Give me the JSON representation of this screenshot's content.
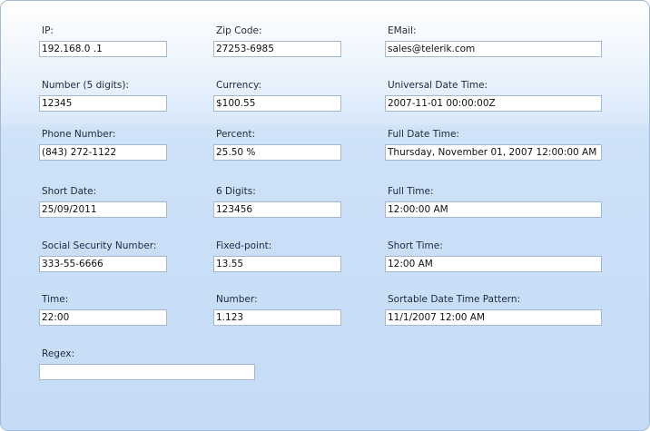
{
  "fields": {
    "ip": {
      "label": "IP:",
      "value": "192.168.0  .1"
    },
    "zip": {
      "label": "Zip Code:",
      "value": "27253-6985"
    },
    "email": {
      "label": "EMail:",
      "value": "sales@telerik.com"
    },
    "number5": {
      "label": "Number (5 digits):",
      "value": "12345"
    },
    "currency": {
      "label": "Currency:",
      "value": "$100.55"
    },
    "universal": {
      "label": "Universal Date Time:",
      "value": "2007-11-01 00:00:00Z"
    },
    "phone": {
      "label": "Phone Number:",
      "value": "(843) 272-1122"
    },
    "percent": {
      "label": "Percent:",
      "value": "25.50 %"
    },
    "fulldatetime": {
      "label": "Full Date Time:",
      "value": "Thursday, November 01, 2007 12:00:00 AM"
    },
    "shortdate": {
      "label": "Short Date:",
      "value": "25/09/2011"
    },
    "sixdigits": {
      "label": "6 Digits:",
      "value": "123456"
    },
    "fulltime": {
      "label": "Full Time:",
      "value": "12:00:00 AM"
    },
    "ssn": {
      "label": "Social Security Number:",
      "value": "333-55-6666"
    },
    "fixedpoint": {
      "label": "Fixed-point:",
      "value": "13.55"
    },
    "shorttime": {
      "label": "Short Time:",
      "value": "12:00 AM"
    },
    "time": {
      "label": "Time:",
      "value": "22:00"
    },
    "number": {
      "label": "Number:",
      "value": "1.123"
    },
    "sortable": {
      "label": "Sortable Date Time Pattern:",
      "value": "11/1/2007 12:00 AM"
    },
    "regex": {
      "label": "Regex:",
      "value": ""
    }
  }
}
